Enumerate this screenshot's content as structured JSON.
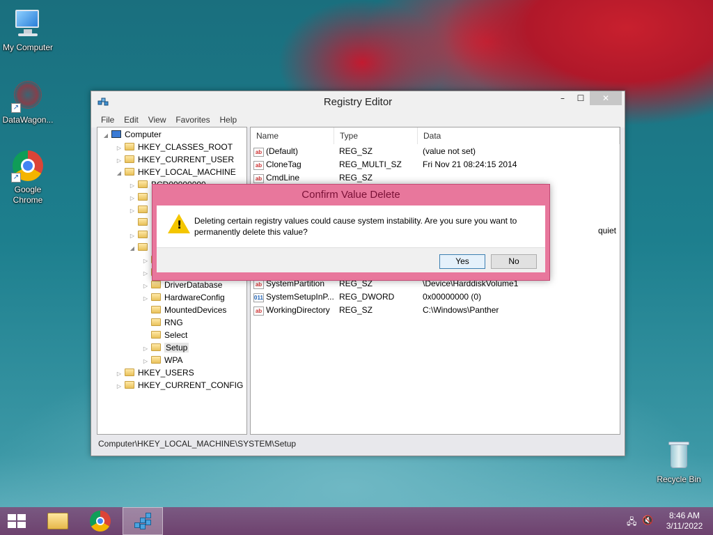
{
  "desktop": {
    "icons": [
      {
        "label": "My Computer"
      },
      {
        "label": "DataWagon..."
      },
      {
        "label": "Google Chrome"
      },
      {
        "label": "Recycle Bin"
      }
    ]
  },
  "window": {
    "title": "Registry Editor",
    "controls": {
      "minimize": "–",
      "maximize": "☐",
      "close": "✕"
    },
    "menu": [
      "File",
      "Edit",
      "View",
      "Favorites",
      "Help"
    ],
    "tree": [
      {
        "label": "Computer",
        "arrow": "◢"
      },
      {
        "label": "HKEY_CLASSES_ROOT",
        "arrow": "▷"
      },
      {
        "label": "HKEY_CURRENT_USER",
        "arrow": "▷"
      },
      {
        "label": "HKEY_LOCAL_MACHINE",
        "arrow": "◢"
      },
      {
        "label": "BCD00000000",
        "arrow": "▷"
      },
      {
        "label": "",
        "arrow": "▷"
      },
      {
        "label": "",
        "arrow": "▷"
      },
      {
        "label": "",
        "arrow": ""
      },
      {
        "label": "",
        "arrow": "▷"
      },
      {
        "label": "",
        "arrow": "◢"
      },
      {
        "label": "",
        "arrow": "▷"
      },
      {
        "label": "",
        "arrow": "▷"
      },
      {
        "label": "DriverDatabase",
        "arrow": "▷"
      },
      {
        "label": "HardwareConfig",
        "arrow": "▷"
      },
      {
        "label": "MountedDevices",
        "arrow": ""
      },
      {
        "label": "RNG",
        "arrow": ""
      },
      {
        "label": "Select",
        "arrow": ""
      },
      {
        "label": "Setup",
        "arrow": "▷"
      },
      {
        "label": "WPA",
        "arrow": "▷"
      },
      {
        "label": "HKEY_USERS",
        "arrow": "▷"
      },
      {
        "label": "HKEY_CURRENT_CONFIG",
        "arrow": "▷"
      }
    ],
    "columns": {
      "name": "Name",
      "type": "Type",
      "data": "Data"
    },
    "values": [
      {
        "icon": "ab",
        "name": "(Default)",
        "type": "REG_SZ",
        "data": "(value not set)"
      },
      {
        "icon": "ab",
        "name": "CloneTag",
        "type": "REG_MULTI_SZ",
        "data": "Fri Nov 21 08:24:15 2014"
      },
      {
        "icon": "ab",
        "name": "CmdLine",
        "type": "REG_SZ",
        "data": ""
      },
      {
        "icon": "",
        "name": "",
        "type": "",
        "data": ""
      },
      {
        "icon": "",
        "name": "",
        "type": "",
        "data": ""
      },
      {
        "icon": "",
        "name": "",
        "type": "",
        "data": "quiet"
      },
      {
        "icon": "",
        "name": "",
        "type": "",
        "data": ""
      },
      {
        "icon": "",
        "name": "",
        "type": "",
        "data": ""
      },
      {
        "icon": "",
        "name": "",
        "type": "",
        "data": ""
      },
      {
        "icon": "ab",
        "name": "SystemPartition",
        "type": "REG_SZ",
        "data": "\\Device\\HarddiskVolume1"
      },
      {
        "icon": "011",
        "name": "SystemSetupInP...",
        "type": "REG_DWORD",
        "data": "0x00000000 (0)"
      },
      {
        "icon": "ab",
        "name": "WorkingDirectory",
        "type": "REG_SZ",
        "data": "C:\\Windows\\Panther"
      }
    ],
    "status": "Computer\\HKEY_LOCAL_MACHINE\\SYSTEM\\Setup"
  },
  "dialog": {
    "title": "Confirm Value Delete",
    "message": "Deleting certain registry values could cause system instability. Are you sure you want to permanently delete this value?",
    "yes": "Yes",
    "no": "No"
  },
  "taskbar": {
    "time": "8:46 AM",
    "date": "3/11/2022"
  }
}
